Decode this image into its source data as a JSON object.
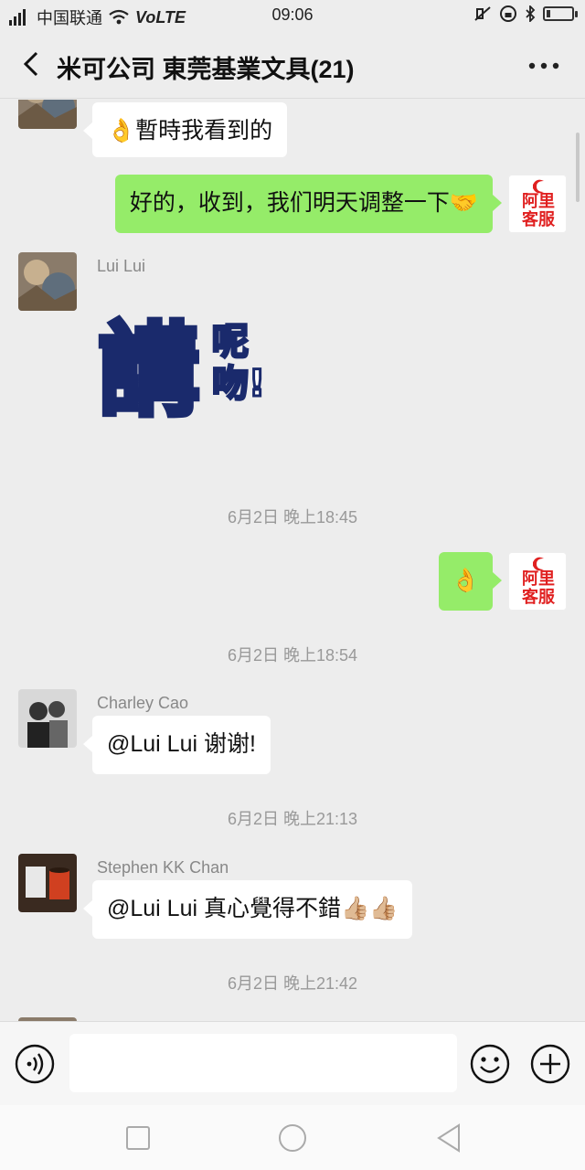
{
  "status": {
    "carrier": "中国联通",
    "network": "VoLTE",
    "time": "09:06",
    "battery_level": 0.15
  },
  "header": {
    "title": "米可公司 東莞基業文具(21)",
    "back_icon": "chevron-left-icon",
    "more_icon": "more-dots-icon"
  },
  "messages": [
    {
      "sender": "",
      "side": "left",
      "type": "text",
      "text": "暫時我看到的",
      "emoji": "👌"
    },
    {
      "sender": "me",
      "side": "right",
      "type": "text",
      "text": "好的，收到，我们明天调整一下",
      "emoji": "🤝"
    },
    {
      "sender": "Lui Lui",
      "side": "left",
      "type": "sticker",
      "sticker_text_main": "講",
      "sticker_text_side": "呢吻!"
    },
    {
      "type": "timestamp",
      "text": "6月2日 晚上18:45"
    },
    {
      "sender": "me",
      "side": "right",
      "type": "emoji",
      "text": "👌"
    },
    {
      "type": "timestamp",
      "text": "6月2日 晚上18:54"
    },
    {
      "sender": "Charley Cao",
      "side": "left",
      "type": "text",
      "text": "@Lui Lui 谢谢!"
    },
    {
      "type": "timestamp",
      "text": "6月2日 晚上21:13"
    },
    {
      "sender": "Stephen KK Chan",
      "side": "left",
      "type": "text",
      "text": "@Lui Lui  真心覺得不錯",
      "emoji": "👍🏼👍🏼"
    },
    {
      "type": "timestamp",
      "text": "6月2日 晚上21:42"
    }
  ],
  "me_avatar_text": "阿里\n客服",
  "input": {
    "placeholder": "",
    "value": ""
  },
  "colors": {
    "green_bubble": "#95ec69",
    "white_bubble": "#ffffff",
    "bg": "#ededed"
  }
}
